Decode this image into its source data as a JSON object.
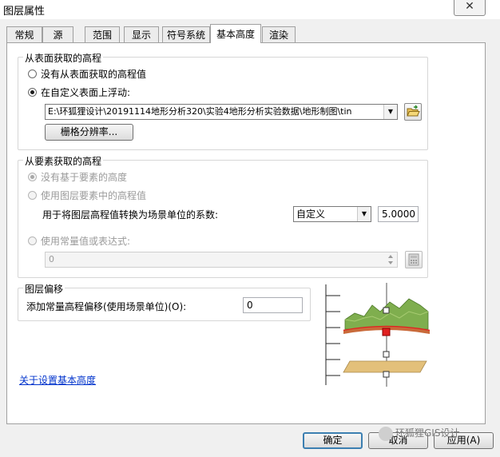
{
  "window": {
    "title": "图层属性",
    "close_label": "✕"
  },
  "tabs": [
    {
      "label": "常规"
    },
    {
      "label": "源"
    },
    {
      "label": "范围"
    },
    {
      "label": "显示"
    },
    {
      "label": "符号系统"
    },
    {
      "label": "基本高度",
      "active": true
    },
    {
      "label": "渲染"
    }
  ],
  "surface_group": {
    "title": "从表面获取的高程",
    "option_none": "没有从表面获取的高程值",
    "option_custom": "在自定义表面上浮动:",
    "surface_path": "E:\\环狐狸设计\\20191114地形分析320\\实验4地形分析实验数据\\地形制图\\tin",
    "raster_button": "栅格分辨率..."
  },
  "feature_group": {
    "title": "从要素获取的高程",
    "option_none": "没有基于要素的高度",
    "option_layer": "使用图层要素中的高程值",
    "factor_label": "用于将图层高程值转换为场景单位的系数:",
    "factor_combo": "自定义",
    "factor_value": "5.0000",
    "option_expression": "使用常量值或表达式:",
    "expression_value": "0"
  },
  "offset_group": {
    "title": "图层偏移",
    "offset_label": "添加常量高程偏移(使用场景单位)(O):",
    "offset_value": "0"
  },
  "help_link": "关于设置基本高度",
  "footer": {
    "ok": "确定",
    "cancel": "取消",
    "apply": "应用(A)"
  },
  "watermark": "环狐狸GIS设计",
  "colors": {
    "accent": "#3c7fb1",
    "terrain": "#7fae4e",
    "base_plane": "#e3c07a",
    "marker": "#e02020"
  }
}
